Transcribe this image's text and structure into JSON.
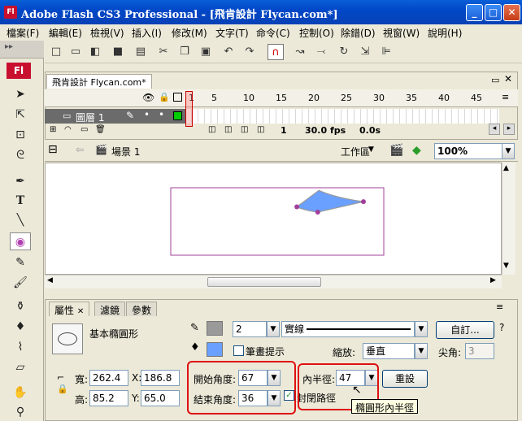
{
  "window": {
    "title": "Adobe Flash CS3 Professional - [飛肯設計  Flycan.com*]",
    "min": "_",
    "max": "□",
    "close": "✕"
  },
  "menu": [
    "檔案(F)",
    "編輯(E)",
    "檢視(V)",
    "插入(I)",
    "修改(M)",
    "文字(T)",
    "命令(C)",
    "控制(O)",
    "除錯(D)",
    "視窗(W)",
    "說明(H)"
  ],
  "tools_logo": "Fl",
  "timeline": {
    "doc_tab": "飛肯設計  Flycan.com*",
    "frame_numbers": [
      "1",
      "5",
      "10",
      "15",
      "20",
      "25",
      "30",
      "35",
      "40",
      "45"
    ],
    "layer_name": "圖層 1",
    "status_frame": "1",
    "status_fps": "30.0 fps",
    "status_time": "0.0s"
  },
  "scene": {
    "label": "場景 1",
    "workspace": "工作區",
    "zoom": "100%"
  },
  "colors": {
    "shape_fill": "#6aa0ff",
    "shape_stroke": "#9a9a9a",
    "selection": "#a0409a"
  },
  "shape": {
    "start_angle_deg": 67,
    "end_angle_deg": 36,
    "inner_radius_pct": 47
  },
  "properties": {
    "tabs": [
      "屬性",
      "濾鏡",
      "參數"
    ],
    "tool_name": "基本橢圓形",
    "stroke_height": "2",
    "stroke_style": "實線",
    "custom_button": "自訂...",
    "stroke_hint_label": "筆畫提示",
    "scale_label": "縮放:",
    "scale_value": "垂直",
    "miter_label": "尖角:",
    "miter_value": "3",
    "width_label": "寬:",
    "width_value": "262.4",
    "height_label": "高:",
    "height_value": "85.2",
    "x_label": "X:",
    "x_value": "186.8",
    "y_label": "Y:",
    "y_value": "65.0",
    "start_angle_label": "開始角度:",
    "start_angle_value": "67",
    "end_angle_label": "結束角度:",
    "end_angle_value": "36",
    "inner_radius_label": "內半徑:",
    "inner_radius_value": "47",
    "reset_button": "重設",
    "close_path_label": "封閉路徑",
    "tooltip": "橢圓形內半徑"
  }
}
